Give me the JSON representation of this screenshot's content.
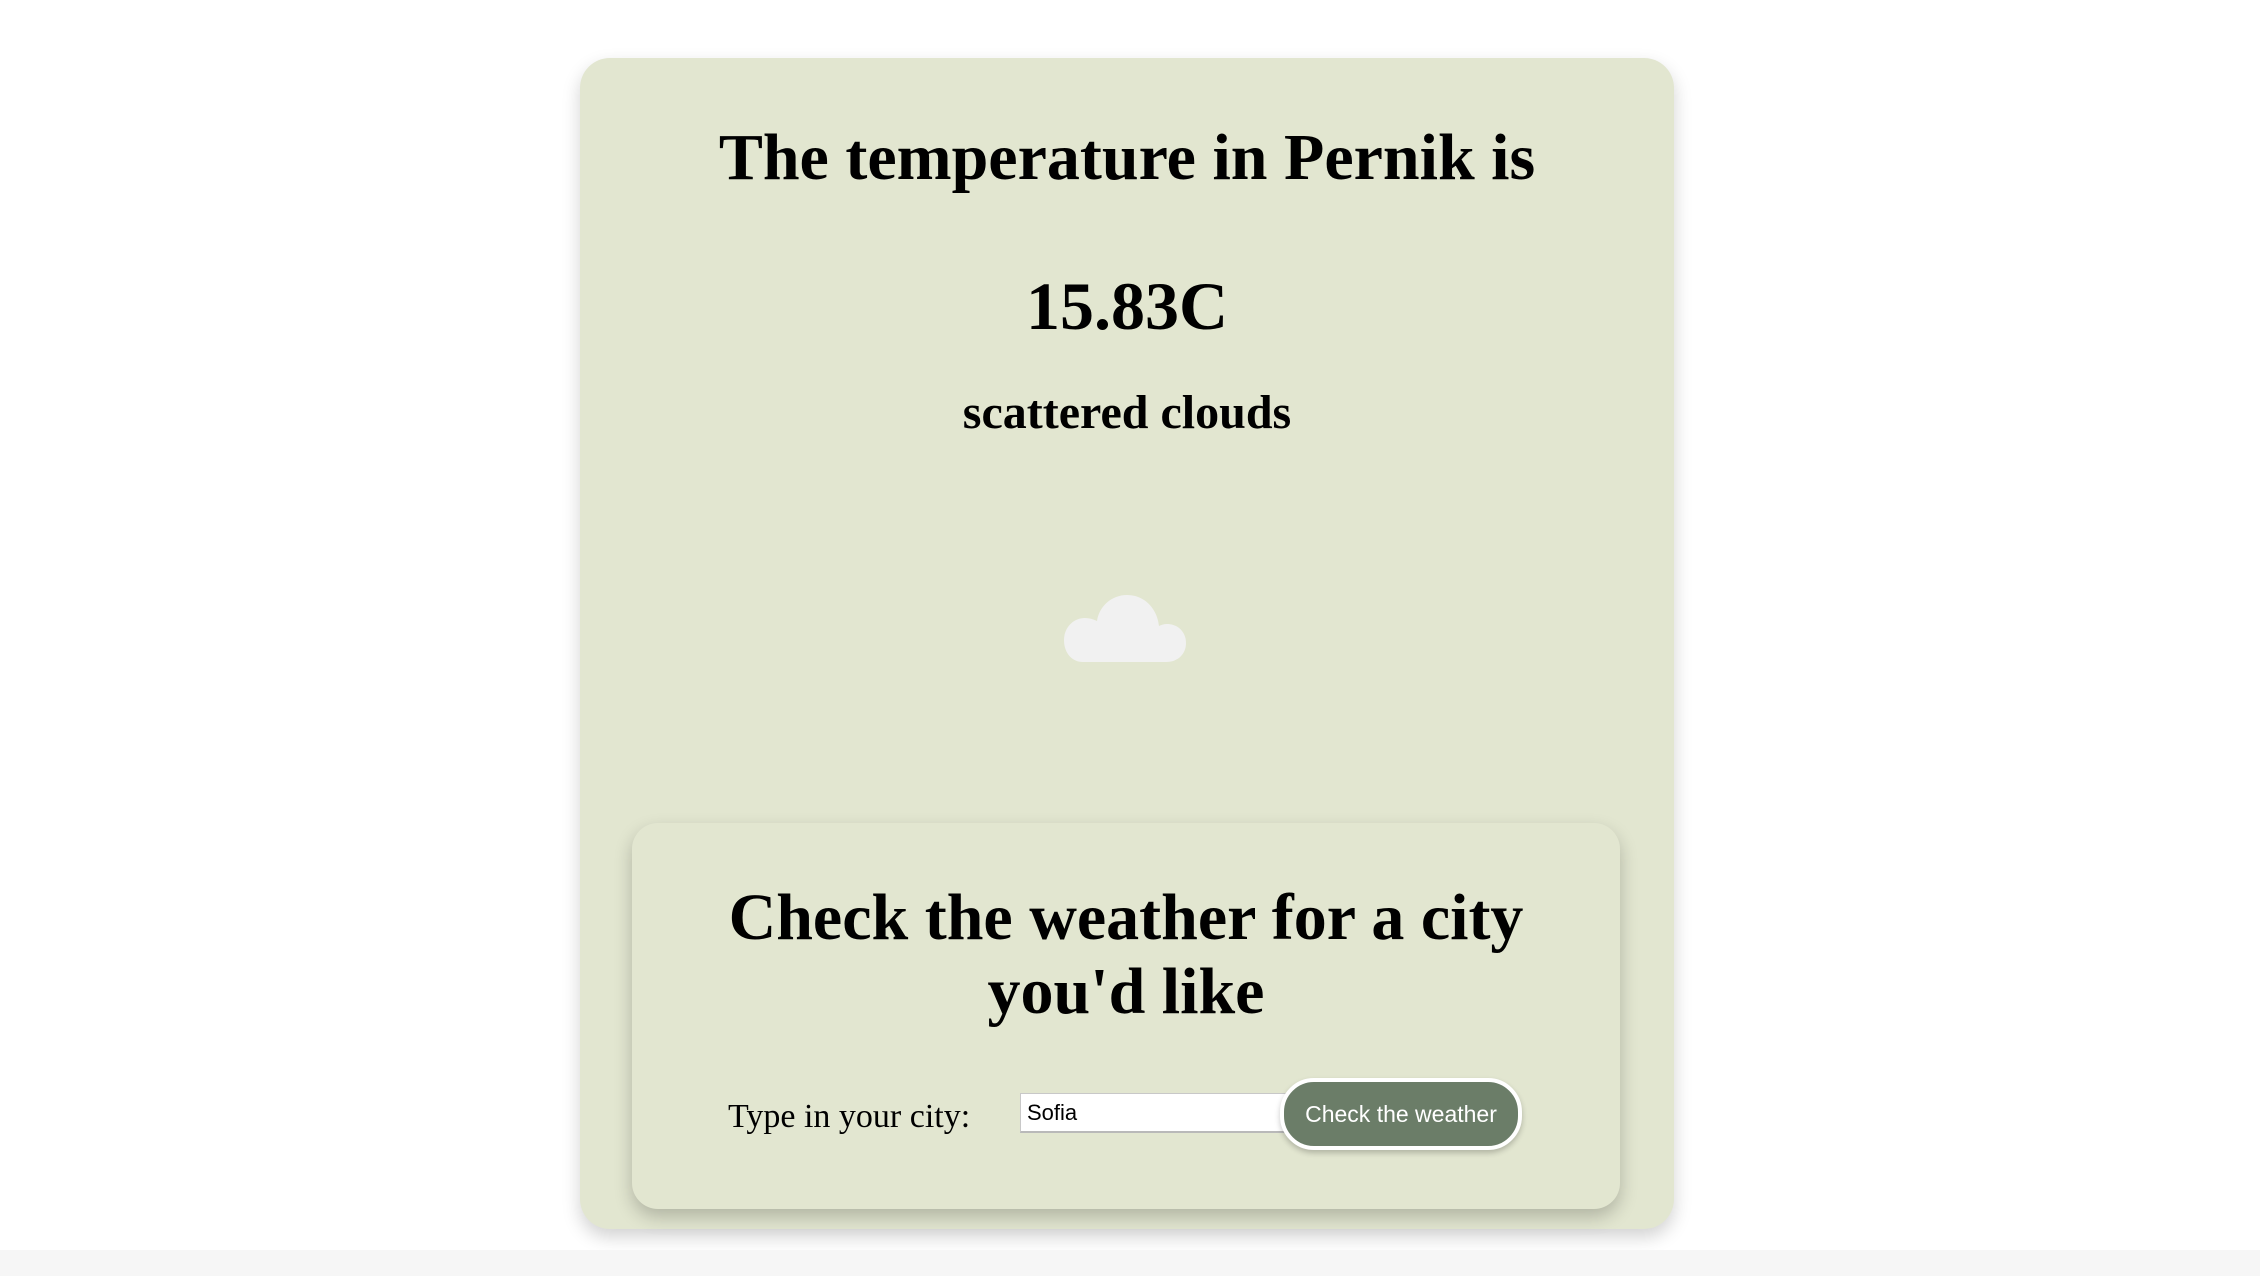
{
  "current": {
    "title": "The temperature in Pernik is",
    "temperature": "15.83C",
    "description": "scattered clouds",
    "icon": "cloud-icon"
  },
  "search": {
    "title": "Check the weather for a city you'd like",
    "label": "Type in your city:",
    "input_value": "Sofia",
    "button_label": "Check the weather"
  },
  "colors": {
    "card_background": "#e2e6d0",
    "button_background": "#6b7d68",
    "cloud": "#f1f1f1"
  }
}
